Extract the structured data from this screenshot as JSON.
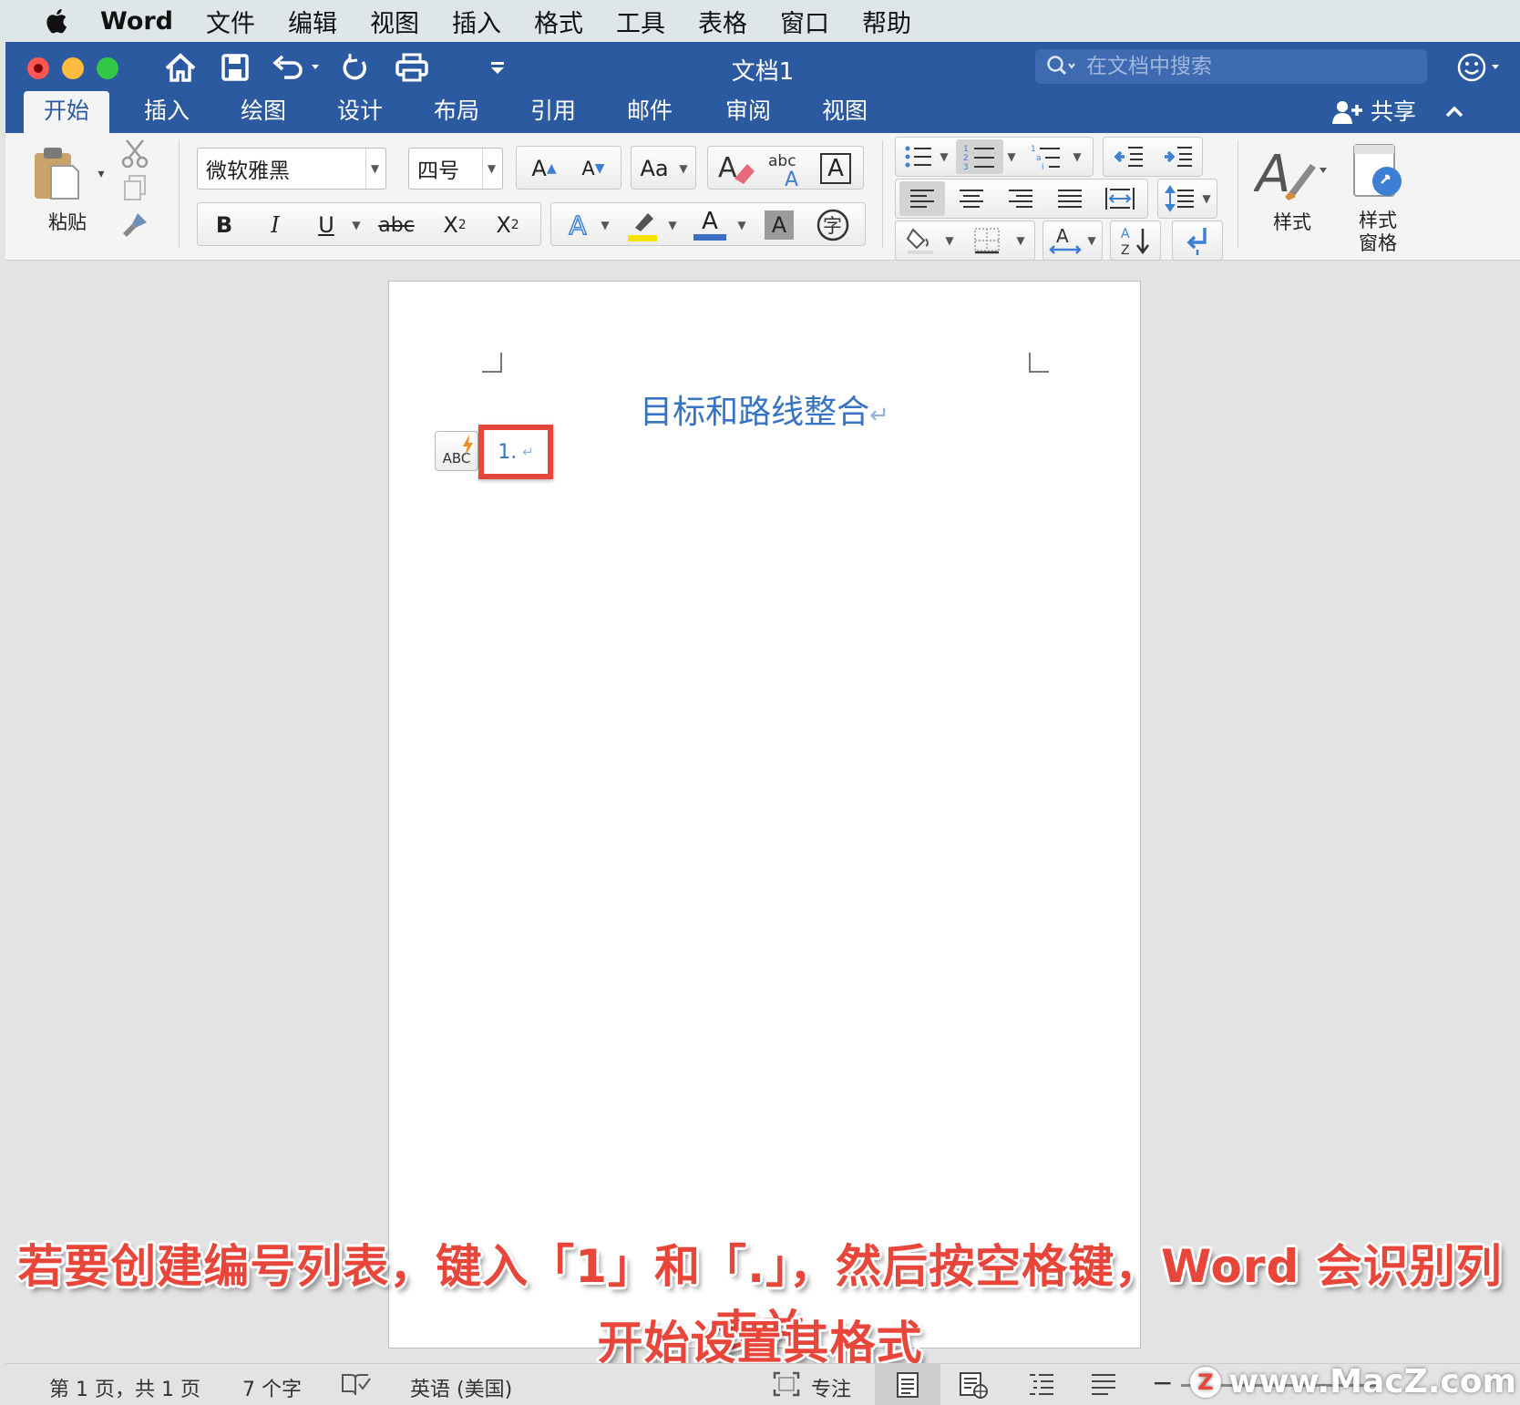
{
  "menubar": {
    "app_name": "Word",
    "items": [
      "文件",
      "编辑",
      "视图",
      "插入",
      "格式",
      "工具",
      "表格",
      "窗口",
      "帮助"
    ]
  },
  "titlebar": {
    "document_title": "文档1",
    "search_placeholder": "在文档中搜索"
  },
  "ribbon_tabs": [
    "开始",
    "插入",
    "绘图",
    "设计",
    "布局",
    "引用",
    "邮件",
    "审阅",
    "视图"
  ],
  "active_tab": "开始",
  "share_label": "共享",
  "home": {
    "paste_label": "粘贴",
    "font_name": "微软雅黑",
    "font_size": "四号",
    "bold": "B",
    "italic": "I",
    "underline": "U",
    "strikethrough": "abc",
    "styles_label": "样式",
    "styles_pane_label_line1": "样式",
    "styles_pane_label_line2": "窗格"
  },
  "document": {
    "heading": "目标和路线整合",
    "list_item": "1.",
    "autocorrect_tag": "ABC"
  },
  "caption": {
    "line1": "若要创建编号列表，键入「1」和「.」，然后按空格键，Word 会识别列表并",
    "line2": "开始设置其格式"
  },
  "statusbar": {
    "page_info": "第 1 页，共 1 页",
    "word_count": "7 个字",
    "language": "英语 (美国)",
    "focus": "专注"
  },
  "watermark": {
    "logo": "Z",
    "text": "www.MacZ.com"
  },
  "colors": {
    "word_blue": "#2c5aa0",
    "heading_blue": "#3673c2",
    "highlight_red": "#e8463b"
  }
}
